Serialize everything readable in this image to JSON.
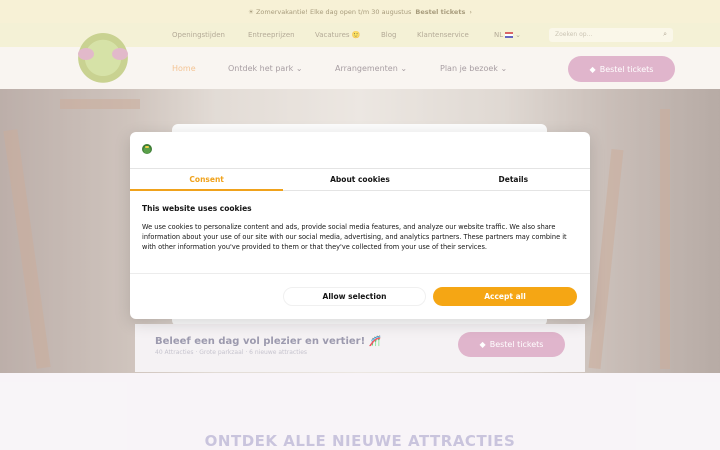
{
  "announcement": {
    "text": "☀ Zomervakantie! Elke dag open t/m 30 augustus",
    "link": "Bestel tickets",
    "arrow": "›"
  },
  "top_nav": {
    "items": [
      "Openingstijden",
      "Entreeprijzen",
      "Vacatures 🙂",
      "Blog",
      "Klantenservice"
    ],
    "language": "NL",
    "search_placeholder": "Zoeken op..."
  },
  "main_nav": {
    "items": [
      "Home",
      "Ontdek het park",
      "Arrangementen",
      "Plan je bezoek"
    ],
    "chevron": "⌄",
    "ticket_button": "Bestel tickets",
    "ticket_icon": "ticket-icon"
  },
  "hero_card": {
    "title": "Beleef een dag vol plezier en vertier! 🎢",
    "subtitle": "40 Attracties · Grote parkzaal · 6 nieuwe attracties",
    "button": "Bestel tickets"
  },
  "section_heading": "ONTDEK ALLE NIEUWE ATTRACTIES",
  "cookie_dialog": {
    "logo": "park-logo",
    "tabs": [
      {
        "label": "Consent",
        "active": true
      },
      {
        "label": "About cookies",
        "active": false
      },
      {
        "label": "Details",
        "active": false
      }
    ],
    "heading": "This website uses cookies",
    "body": "We use cookies to personalize content and ads, provide social media features, and analyze our website traffic. We also share information about your use of our site with our social media, advertising, and analytics partners. These partners may combine it with other information you've provided to them or that they've collected from your use of their services.",
    "allow_selection": "Allow selection",
    "accept_all": "Accept all",
    "accent_color": "#f5a614"
  }
}
